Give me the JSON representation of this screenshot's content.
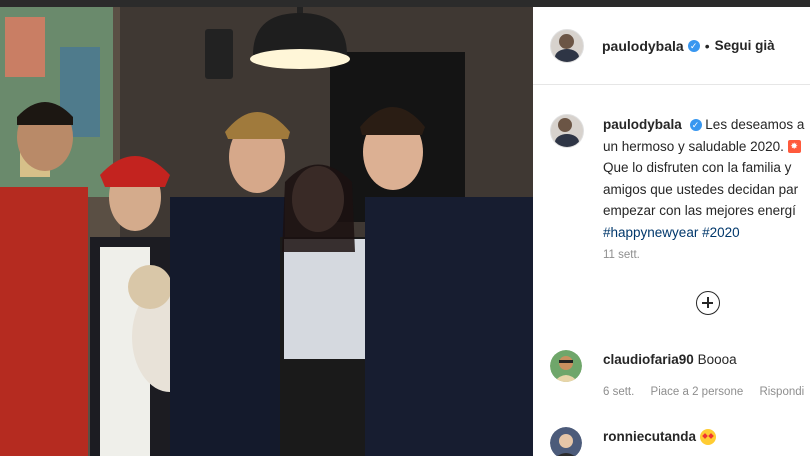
{
  "post": {
    "image_alt": "Group photo of five people in a living room with a small dog",
    "author": {
      "username": "paulodybala",
      "verified": true,
      "follow_status": "Segui già",
      "separator": "•"
    },
    "caption": {
      "username": "paulodybala",
      "lines": [
        "Les deseamos a",
        "un hermoso y saludable 2020.",
        "Que lo disfruten con la familia y",
        "amigos que ustedes decidan par",
        "empezar con las mejores energí"
      ],
      "hashtags": "#happynewyear #2020",
      "emoji": "💥",
      "time": "11 sett."
    },
    "comments": [
      {
        "username": "claudiofaria90",
        "text": "Boooa",
        "time": "6 sett.",
        "likes": "Piace a 2 persone",
        "reply": "Rispondi"
      },
      {
        "username": "ronniecutanda",
        "text": "😍",
        "time": "",
        "likes": "",
        "reply": ""
      }
    ]
  },
  "colors": {
    "link": "#00376b",
    "verified": "#3897f0",
    "muted": "#8e8e8e",
    "text": "#262626"
  }
}
